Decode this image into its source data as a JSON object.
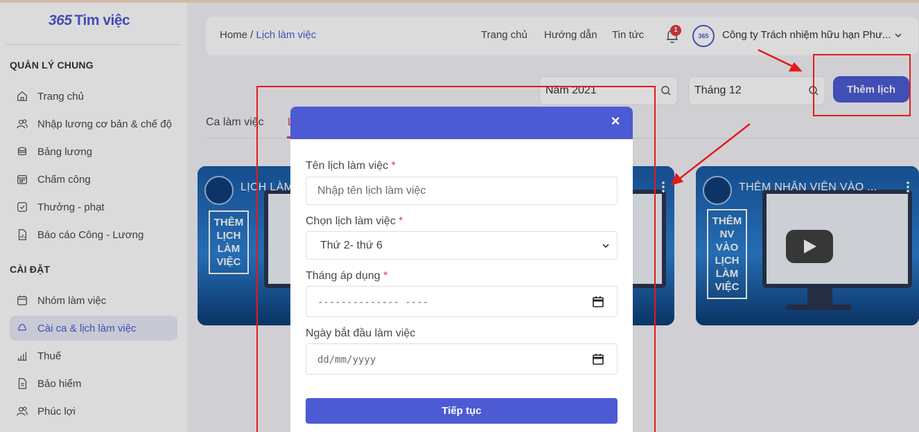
{
  "app": {
    "logo_num": "365",
    "logo_text": "Tim việc"
  },
  "sidebar": {
    "sections": [
      {
        "title": "QUẢN LÝ CHUNG"
      },
      {
        "title": "CÀI ĐẶT"
      }
    ],
    "items": [
      {
        "label": "Trang chủ",
        "icon": "home-icon"
      },
      {
        "label": "Nhập lương cơ bản & chế độ",
        "icon": "users-icon"
      },
      {
        "label": "Bảng lương",
        "icon": "coins-icon"
      },
      {
        "label": "Chấm công",
        "icon": "calendar-grid-icon"
      },
      {
        "label": "Thưởng - phạt",
        "icon": "check-square-icon"
      },
      {
        "label": "Báo cáo Công - Lương",
        "icon": "report-icon"
      },
      {
        "label": "Nhóm làm việc",
        "icon": "calendar-icon"
      },
      {
        "label": "Cài ca & lịch làm việc",
        "icon": "recycle-icon",
        "active": true
      },
      {
        "label": "Thuế",
        "icon": "bar-chart-icon"
      },
      {
        "label": "Bảo hiểm",
        "icon": "document-icon"
      },
      {
        "label": "Phúc lợi",
        "icon": "users-icon"
      }
    ]
  },
  "header": {
    "breadcrumb_home": "Home",
    "breadcrumb_sep": " / ",
    "breadcrumb_current": "Lịch làm việc",
    "nav": [
      "Trang chủ",
      "Hướng dẫn",
      "Tin tức"
    ],
    "notification_count": "1",
    "avatar_text": "365",
    "company": "Công ty Trách nhiệm hữu hạn Phư..."
  },
  "filters": {
    "year": "Năm 2021",
    "month": "Tháng 12",
    "add_button": "Thêm lịch"
  },
  "tabs": [
    "Ca làm việc",
    "L"
  ],
  "videos": [
    {
      "title": "LỊCH LÀM",
      "side": [
        "THÊM",
        "LỊCH",
        "LÀM",
        "VIỆC"
      ]
    },
    {
      "title": "THÊM NHÂN VIÊN VÀO ...",
      "side": [
        "THÊM",
        "NV",
        "VÀO",
        "LỊCH",
        "LÀM",
        "VIỆC"
      ]
    }
  ],
  "modal": {
    "close": "×",
    "fields": {
      "name_label": "Tên lịch làm việc",
      "name_placeholder": "Nhập tên lịch làm việc",
      "choose_label": "Chọn lịch làm việc",
      "choose_value": "Thứ 2- thứ 6",
      "month_label": "Tháng áp dụng",
      "month_placeholder": "-------------- ----",
      "start_label": "Ngày bắt đầu làm việc",
      "start_placeholder": "dd/mm/yyyy"
    },
    "required_mark": "*",
    "submit": "Tiếp tục"
  },
  "colors": {
    "accent": "#4c5bd4",
    "annotation_red": "#e21b1b"
  }
}
